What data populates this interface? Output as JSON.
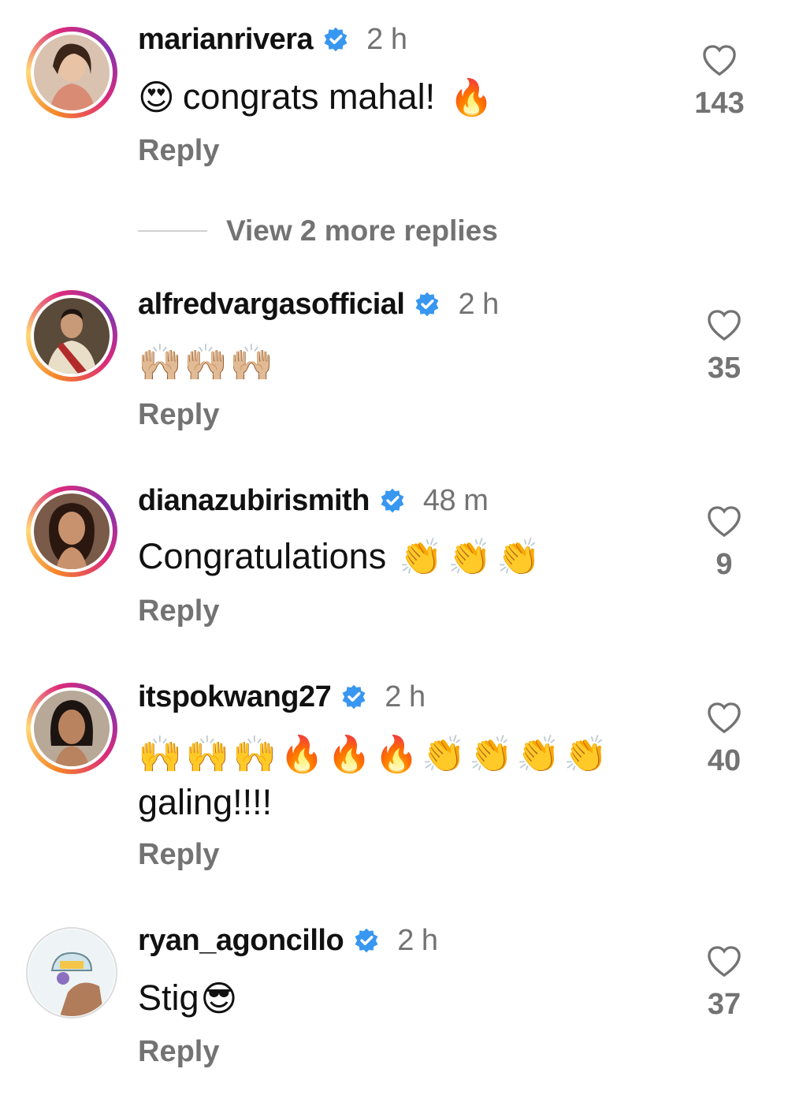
{
  "comments": [
    {
      "username": "marianrivera",
      "time": "2 h",
      "text": "congrats mahal!",
      "emoji_before": "😍",
      "emoji_after": "🔥",
      "reply": "Reply",
      "likes": "143"
    },
    {
      "username": "alfredvargasofficial",
      "time": "2 h",
      "text": "🙌🏼🙌🏼🙌🏼",
      "reply": "Reply",
      "likes": "35"
    },
    {
      "username": "dianazubirismith",
      "time": "48 m",
      "text": "Congratulations",
      "emoji_after": "👏👏👏",
      "reply": "Reply",
      "likes": "9"
    },
    {
      "username": "itspokwang27",
      "time": "2 h",
      "text": "🙌🙌🙌🔥🔥🔥👏👏👏👏",
      "text2": "galing!!!!",
      "reply": "Reply",
      "likes": "40"
    },
    {
      "username": "ryan_agoncillo",
      "time": "2 h",
      "text": "Stig",
      "emoji_after": "😎",
      "reply": "Reply",
      "likes": "37"
    }
  ],
  "view_more_replies": "View 2 more replies",
  "colors": {
    "verified": "#3897f0",
    "muted": "#737373",
    "text": "#111111"
  },
  "icons": {
    "like": "heart-outline-icon",
    "verified": "verified-badge-icon"
  }
}
